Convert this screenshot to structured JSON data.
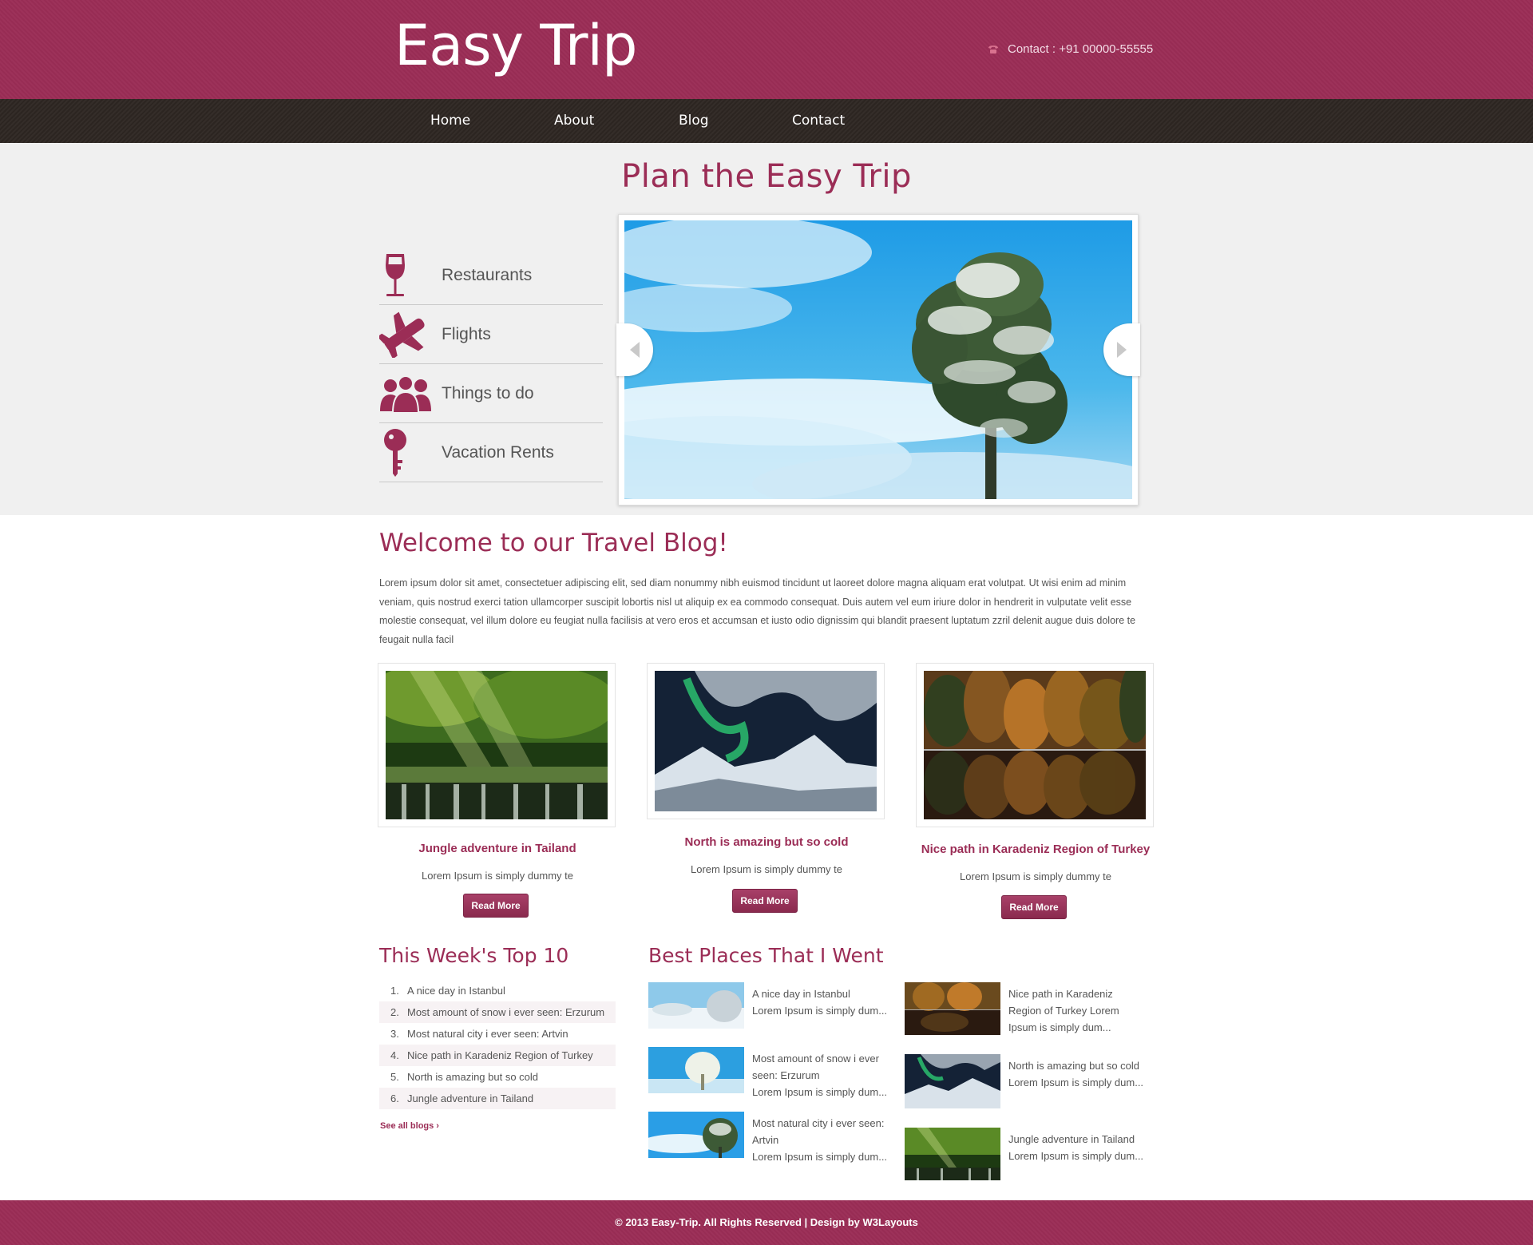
{
  "header": {
    "logo": "Easy Trip",
    "contact": "Contact : +91 00000-55555"
  },
  "nav": [
    "Home",
    "About",
    "Blog",
    "Contact"
  ],
  "hero": {
    "title": "Plan the Easy Trip",
    "services": [
      "Restaurants",
      "Flights",
      "Things to do",
      "Vacation Rents"
    ]
  },
  "welcome": {
    "title": "Welcome to our Travel Blog!",
    "text": "Lorem ipsum dolor sit amet, consectetuer adipiscing elit, sed diam nonummy nibh euismod tincidunt ut laoreet dolore magna aliquam erat volutpat. Ut wisi enim ad minim veniam, quis nostrud exerci tation ullamcorper suscipit lobortis nisl ut aliquip ex ea commodo consequat. Duis autem vel eum iriure dolor in hendrerit in vulputate velit esse molestie consequat, vel illum dolore eu feugiat nulla facilisis at vero eros et accumsan et iusto odio dignissim qui blandit praesent luptatum zzril delenit augue duis dolore te feugait nulla facil"
  },
  "cards": [
    {
      "title": "Jungle adventure in Tailand",
      "text": "Lorem Ipsum is simply dummy te",
      "button": "Read More"
    },
    {
      "title": "North is amazing but so cold",
      "text": "Lorem Ipsum is simply dummy te",
      "button": "Read More"
    },
    {
      "title": "Nice path in Karadeniz Region of Turkey",
      "text": "Lorem Ipsum is simply dummy te",
      "button": "Read More"
    }
  ],
  "top10": {
    "title": "This Week's Top 10",
    "items": [
      "A nice day in Istanbul",
      "Most amount of snow i ever seen: Erzurum",
      "Most natural city i ever seen: Artvin",
      "Nice path in Karadeniz Region of Turkey",
      "North is amazing but so cold",
      "Jungle adventure in Tailand"
    ],
    "see_all": "See all blogs ›"
  },
  "best_places": {
    "title": "Best Places That I Went",
    "items": [
      {
        "lines": [
          "A nice day in Istanbul",
          "Lorem Ipsum is simply dum..."
        ]
      },
      {
        "lines": [
          "Nice path in Karadeniz",
          "Region of Turkey Lorem",
          "Ipsum is simply dum..."
        ]
      },
      {
        "lines": [
          "Most amount of snow i ever",
          "seen: Erzurum",
          "Lorem Ipsum is simply dum..."
        ]
      },
      {
        "lines": [
          "North is amazing but so cold",
          "Lorem Ipsum is simply dum..."
        ]
      },
      {
        "lines": [
          "Most natural city i ever seen:",
          "Artvin",
          "Lorem Ipsum is simply dum..."
        ]
      },
      {
        "lines": [
          "Jungle adventure in Tailand",
          "Lorem Ipsum is simply dum..."
        ]
      }
    ]
  },
  "footer": "© 2013 Easy-Trip. All Rights Reserved | Design by W3Layouts",
  "colors": {
    "brand": "#9b2d56",
    "nav": "#2e2622",
    "hero_bg": "#f0f0f0"
  }
}
